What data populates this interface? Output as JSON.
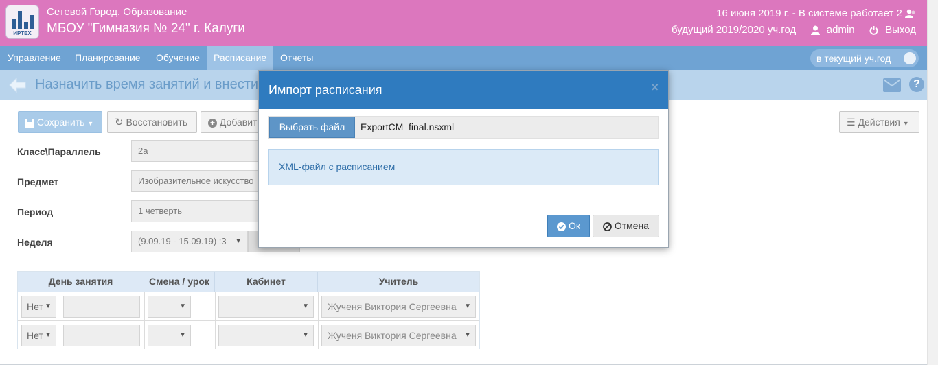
{
  "header": {
    "system_name": "Сетевой Город. Образование",
    "school_name": "МБОУ \"Гимназия № 24\" г. Калуги",
    "date_status": "16 июня 2019 г. - В системе работает 2",
    "year": "будущий 2019/2020 уч.год",
    "user": "admin",
    "logout": "Выход",
    "logo_text": "ИРТЕХ"
  },
  "nav": {
    "items": [
      "Управление",
      "Планирование",
      "Обучение",
      "Расписание",
      "Отчеты"
    ],
    "active": "Расписание",
    "toggle_label": "в текущий уч.год"
  },
  "page": {
    "title": "Назначить время занятий и внести"
  },
  "toolbar": {
    "save": "Сохранить",
    "restore": "Восстановить",
    "add": "Добавить",
    "actions": "Действия"
  },
  "form": {
    "class_label": "Класс\\Параллель",
    "class_value": "2а",
    "subject_label": "Предмет",
    "subject_value": "Изобразительное искусство",
    "period_label": "Период",
    "period_value": "1 четверть",
    "week_label": "Неделя",
    "week_value": "(9.09.19 - 15.09.19) :3"
  },
  "table": {
    "headers": [
      "День занятия",
      "Смена / урок",
      "Кабинет",
      "Учитель"
    ],
    "rows": [
      {
        "day": "Нет",
        "teacher": "Жученя Виктория Сергеевна"
      },
      {
        "day": "Нет",
        "teacher": "Жученя Виктория Сергеевна"
      }
    ]
  },
  "modal": {
    "title": "Импорт расписания",
    "close": "×",
    "choose_file": "Выбрать файл",
    "file_name": "ExportCM_final.nsxml",
    "info": "XML-файл с расписанием",
    "ok": "Ок",
    "cancel": "Отмена"
  },
  "colors": {
    "header_bg": "#dc77be",
    "nav_bg": "#6fa3d3",
    "modal_header": "#2f7bbf",
    "accent": "#5b98cf"
  }
}
